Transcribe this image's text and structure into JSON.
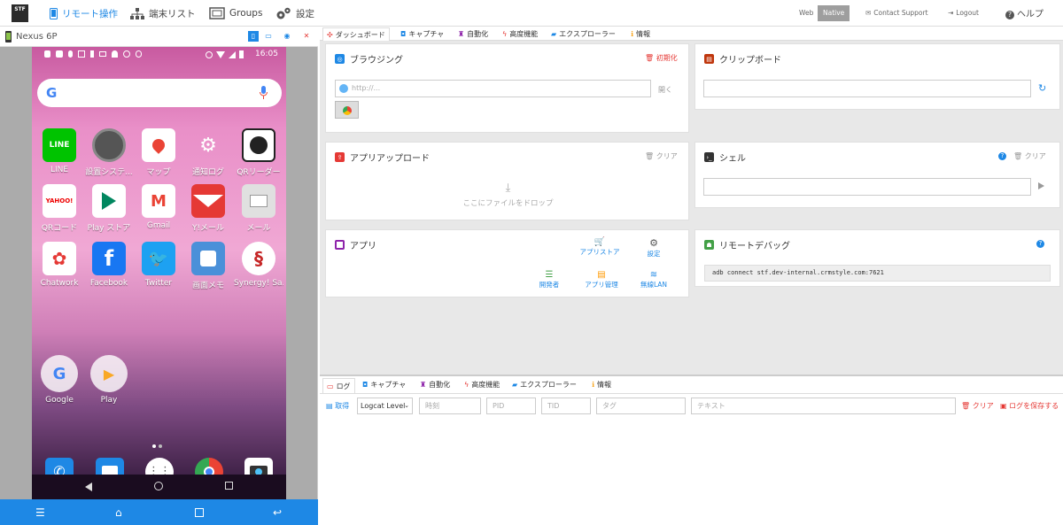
{
  "topbar": {
    "logo_top": "STF",
    "nav": {
      "remote": "リモート操作",
      "devices": "端末リスト",
      "groups": "Groups",
      "settings": "設定"
    },
    "mode_web": "Web",
    "mode_native": "Native",
    "contact": "Contact Support",
    "logout": "Logout",
    "help": "ヘルプ"
  },
  "device": {
    "name": "Nexus 6P",
    "time": "16:05",
    "apps_row1": [
      "LINE",
      "設置システ...",
      "マップ",
      "通知ログ",
      "QRリーダー"
    ],
    "apps_row2": [
      "QRコード",
      "Play ストア",
      "Gmail",
      "Y!メール",
      "メール"
    ],
    "apps_row3": [
      "Chatwork",
      "Facebook",
      "Twitter",
      "画面メモ",
      "Synergy! Sa..."
    ],
    "apps_row4": [
      "Google",
      "Play"
    ]
  },
  "tabs": {
    "dashboard": "ダッシュボード",
    "capture": "キャプチャ",
    "automation": "自動化",
    "advanced": "高度機能",
    "explorer": "エクスプローラー",
    "info": "情報"
  },
  "browsing": {
    "title": "ブラウジング",
    "reset": "初期化",
    "placeholder": "http://...",
    "open": "開く"
  },
  "clipboard": {
    "title": "クリップボード"
  },
  "upload": {
    "title": "アプリアップロード",
    "clear": "クリア",
    "drop": "ここにファイルをドロップ"
  },
  "shell": {
    "title": "シェル",
    "clear": "クリア"
  },
  "apps": {
    "title": "アプリ",
    "store": "アプリストア",
    "settings": "設定",
    "developer": "開発者",
    "manage": "アプリ管理",
    "wifi": "無線LAN"
  },
  "remote_debug": {
    "title": "リモートデバッグ",
    "command": "adb connect stf.dev-internal.crmstyle.com:7621"
  },
  "logtabs": {
    "log": "ログ",
    "capture": "キャプチャ",
    "automation": "自動化",
    "advanced": "高度機能",
    "explorer": "エクスプローラー",
    "info": "情報"
  },
  "logbar": {
    "get": "取得",
    "level": "Logcat Level",
    "time": "時刻",
    "pid": "PID",
    "tid": "TID",
    "tag": "タグ",
    "text": "テキスト",
    "clear": "クリア",
    "save": "ログを保存する"
  },
  "colors": {
    "accent": "#1e88e5",
    "danger": "#e53935"
  }
}
